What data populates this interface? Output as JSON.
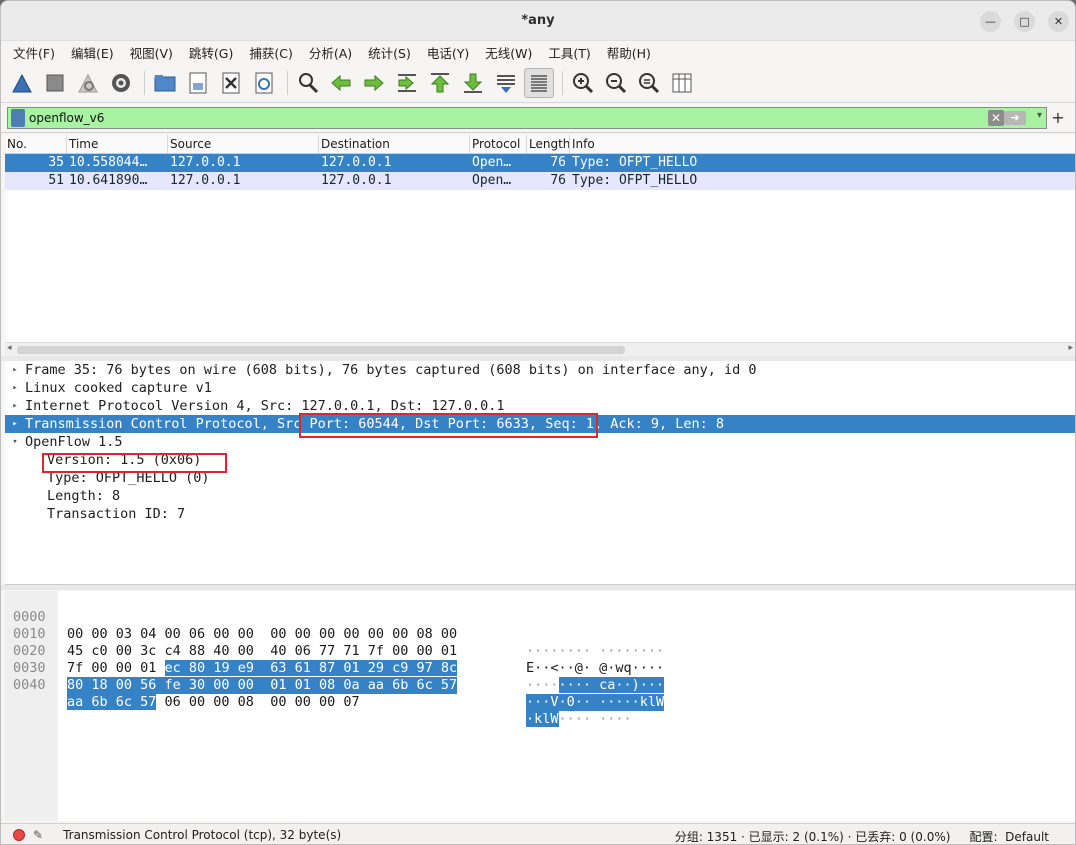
{
  "window": {
    "title": "*any",
    "minimize": "—",
    "maximize": "□",
    "close": "✕"
  },
  "menu": [
    "文件(F)",
    "编辑(E)",
    "视图(V)",
    "跳转(G)",
    "捕获(C)",
    "分析(A)",
    "统计(S)",
    "电话(Y)",
    "无线(W)",
    "工具(T)",
    "帮助(H)"
  ],
  "toolbar_icons": [
    "shark-fin-start-icon",
    "stop-icon",
    "restart-icon",
    "options-gear-icon",
    "open-folder-icon",
    "save-file-icon",
    "close-file-icon",
    "reload-icon",
    "find-icon",
    "go-back-icon",
    "go-forward-icon",
    "go-to-packet-icon",
    "first-packet-icon",
    "last-packet-icon",
    "autoscroll-icon",
    "colorize-icon",
    "zoom-in-icon",
    "zoom-out-icon",
    "zoom-reset-icon",
    "resize-columns-icon"
  ],
  "filter": {
    "value": "openflow_v6",
    "plus": "+"
  },
  "columns": [
    "No.",
    "Time",
    "Source",
    "Destination",
    "Protocol",
    "Length",
    "Info"
  ],
  "packets": [
    {
      "no": "35",
      "time": "10.558044…",
      "src": "127.0.0.1",
      "dst": "127.0.0.1",
      "proto": "Open…",
      "len": "76",
      "info": "Type: OFPT_HELLO"
    },
    {
      "no": "51",
      "time": "10.641890…",
      "src": "127.0.0.1",
      "dst": "127.0.0.1",
      "proto": "Open…",
      "len": "76",
      "info": "Type: OFPT_HELLO"
    }
  ],
  "details": {
    "frame": "Frame 35: 76 bytes on wire (608 bits), 76 bytes captured (608 bits) on interface any, id 0",
    "linux": "Linux cooked capture v1",
    "ip": "Internet Protocol Version 4, Src: 127.0.0.1, Dst: 127.0.0.1",
    "tcp_a": "Transmission Control Protocol, ",
    "tcp_b": "Src Port: 60544, Dst Port: 6633,",
    "tcp_c": " Seq: 1, Ack: 9, Len: 8",
    "of": "OpenFlow 1.5",
    "version": "Version: 1.5 (0x06)",
    "type": "Type: OFPT_HELLO (0)",
    "length": "Length: 8",
    "xid": "Transaction ID: 7"
  },
  "bytes": {
    "r0": {
      "off": "0000",
      "hex": "00 00 03 04 00 06 00 00  00 00 00 00 00 00 08 00",
      "asc": "········ ········"
    },
    "r1": {
      "off": "0010",
      "hex": "45 c0 00 3c c4 88 40 00  40 06 77 71 7f 00 00 01",
      "asc": "E··<··@· @·wq····"
    },
    "r2": {
      "off": "0020",
      "hex_a": "7f 00 00 01 ",
      "hex_b": "ec 80 19 e9  63 61 87 01 29 c9 97 8c",
      "asc_a": "····",
      "asc_b": "···· ca··)···"
    },
    "r3": {
      "off": "0030",
      "hex": "80 18 00 56 fe 30 00 00  01 01 08 0a aa 6b 6c 57",
      "asc": "···V·0·· ·····klW"
    },
    "r4": {
      "off": "0040",
      "hex_a": "aa 6b 6c 57",
      "hex_b": " 06 00 00 08  00 00 00 07",
      "asc_a": "·klW",
      "asc_b": "···· ····"
    }
  },
  "status": {
    "left": "Transmission Control Protocol (tcp), 32 byte(s)",
    "right": "分组: 1351 · 已显示: 2 (0.1%) · 已丢弃: 0 (0.0%)     配置:  Default"
  }
}
